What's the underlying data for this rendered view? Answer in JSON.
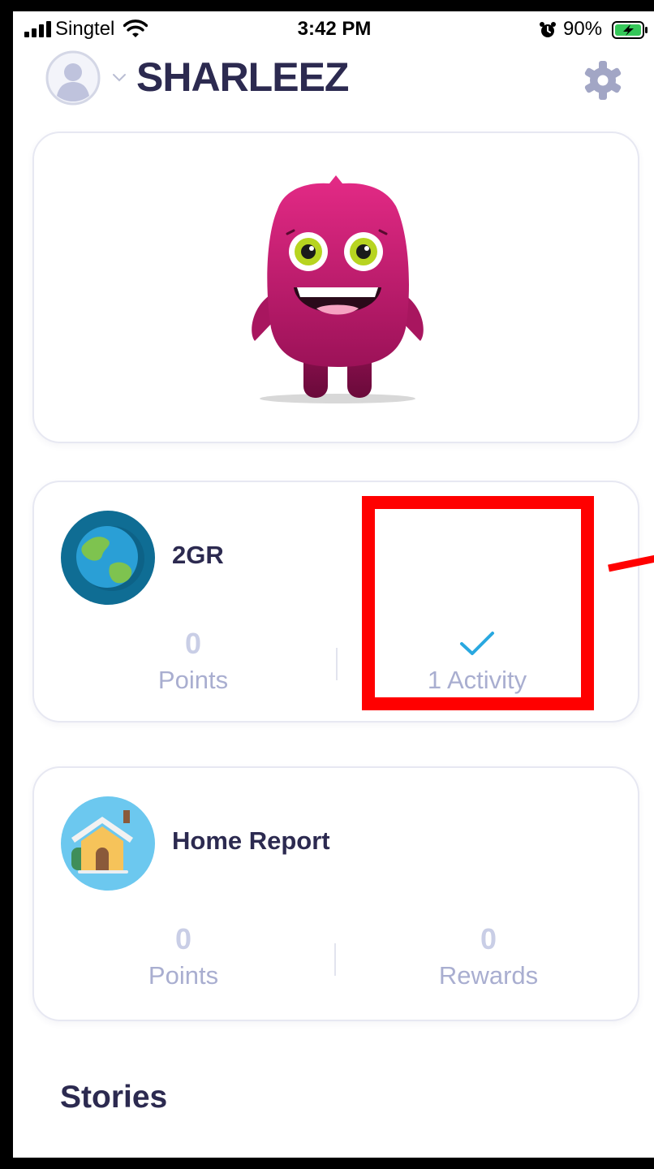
{
  "status_bar": {
    "carrier": "Singtel",
    "time": "3:42 PM",
    "battery_percent": "90%",
    "icons": [
      "signal-icon",
      "wifi-icon",
      "alarm-icon",
      "battery-charging-icon"
    ]
  },
  "header": {
    "student_name": "SHARLEEZ",
    "icons": [
      "avatar-icon",
      "chevron-down-icon",
      "gear-icon"
    ]
  },
  "monster": {
    "icon": "pink-monster-avatar"
  },
  "class_card": {
    "icon": "globe-icon",
    "title": "2GR",
    "points_value": "0",
    "points_label": "Points",
    "activity_icon": "check-icon",
    "activity_label": "1 Activity"
  },
  "home_card": {
    "icon": "house-icon",
    "title": "Home Report",
    "points_value": "0",
    "points_label": "Points",
    "rewards_value": "0",
    "rewards_label": "Rewards"
  },
  "stories": {
    "title": "Stories"
  },
  "colors": {
    "title_text": "#2c2a50",
    "stat_value": "#c9cee6",
    "stat_label": "#a9aed0",
    "accent_check": "#29a8e0",
    "monster_pink": "#c41e6e",
    "annotation_red": "#ff0000"
  }
}
